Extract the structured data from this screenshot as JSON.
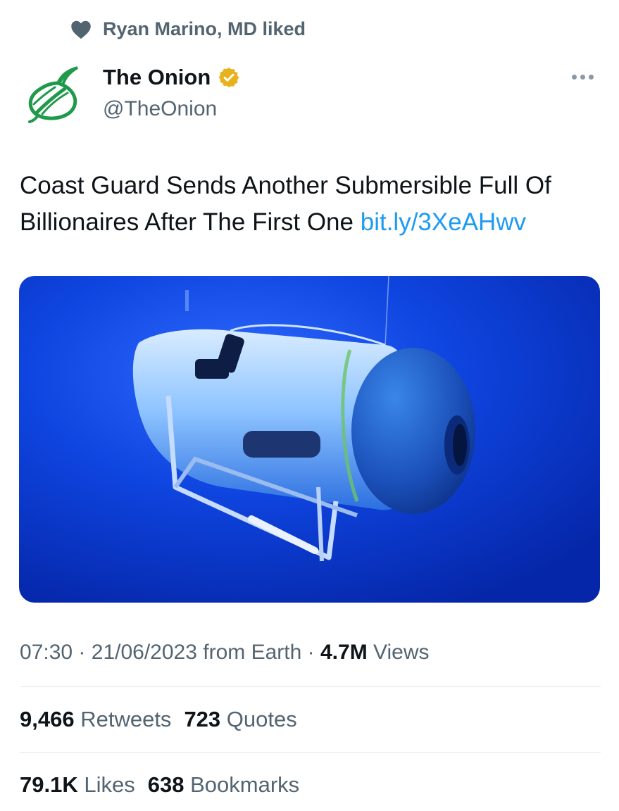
{
  "social_context": {
    "icon": "heart-icon",
    "text": "Ryan Marino, MD liked"
  },
  "author": {
    "name": "The Onion",
    "handle": "@TheOnion",
    "verified_icon": "gold-verified-badge-icon",
    "avatar_icon": "onion-logo-icon"
  },
  "tweet": {
    "text": "Coast Guard Sends Another Submersible Full Of Billionaires After The First One",
    "link": "bit.ly/3XeAHwv"
  },
  "meta": {
    "time": "07:30",
    "separator": "·",
    "date": "21/06/2023",
    "source": "from Earth",
    "views_count": "4.7M",
    "views_label": "Views"
  },
  "stats": {
    "retweets_count": "9,466",
    "retweets_label": "Retweets",
    "quotes_count": "723",
    "quotes_label": "Quotes",
    "likes_count": "79.1K",
    "likes_label": "Likes",
    "bookmarks_count": "638",
    "bookmarks_label": "Bookmarks"
  },
  "colors": {
    "link": "#1d9bf0",
    "secondary_text": "#536471",
    "onion_green": "#1f9a4a",
    "verified_gold": "#e8b21d",
    "ocean_blue": "#0a3bd6"
  }
}
